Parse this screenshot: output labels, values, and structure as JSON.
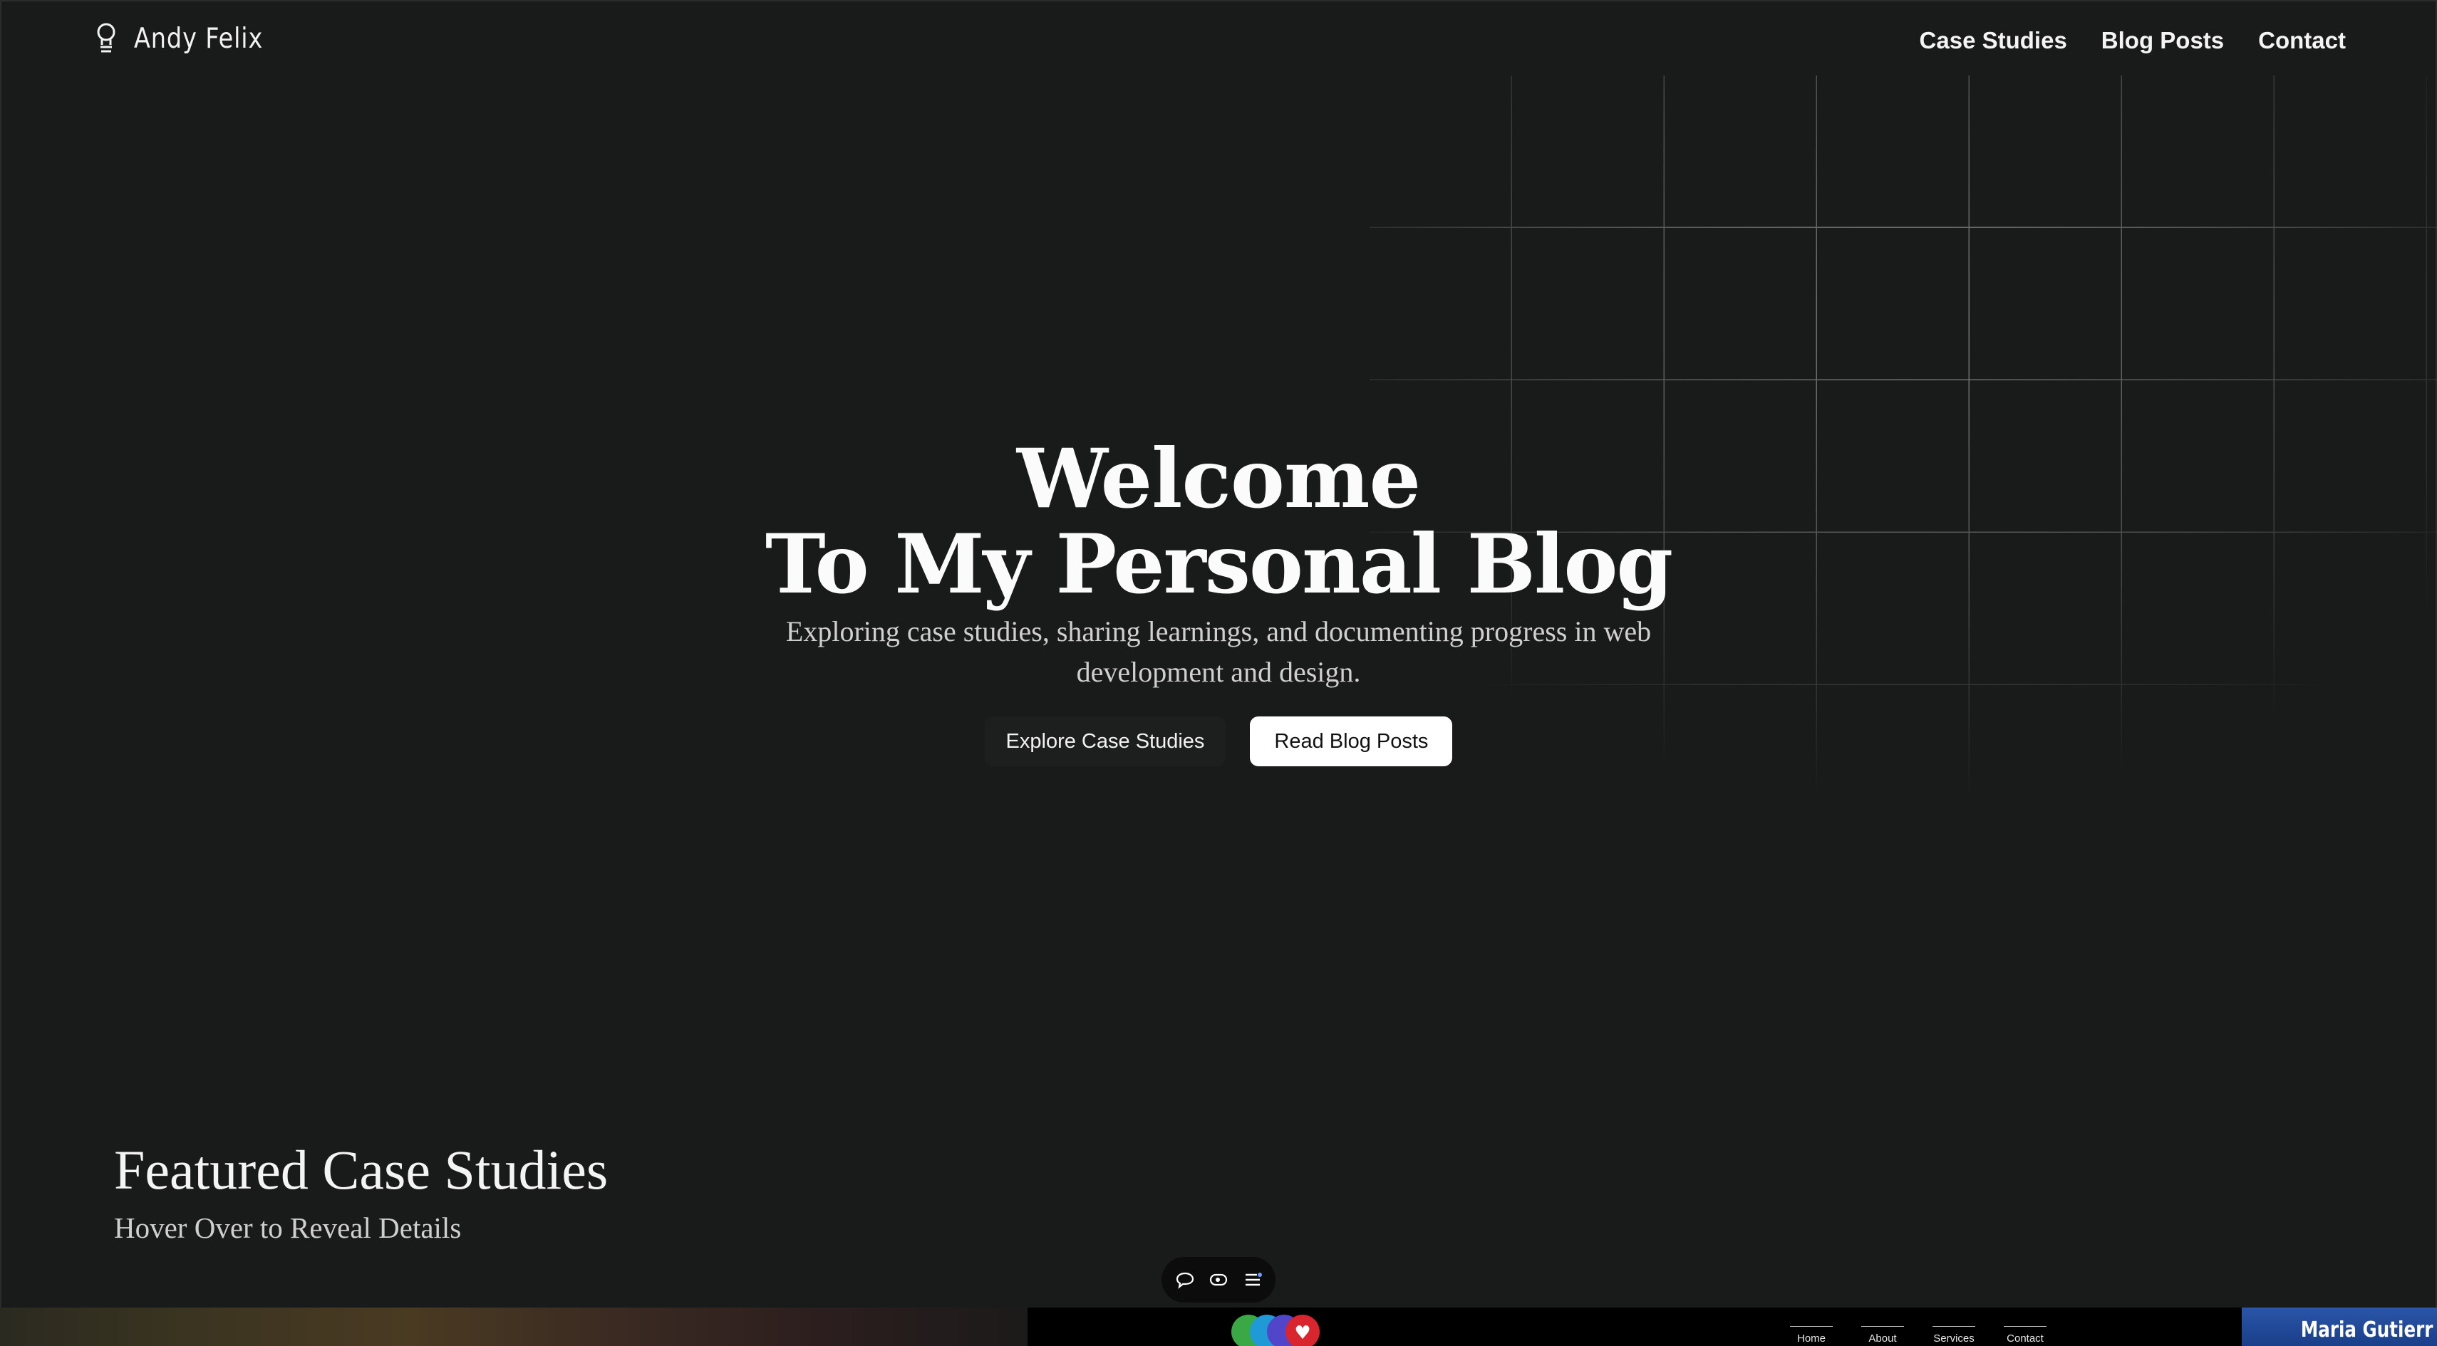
{
  "header": {
    "brand": "Andy Felix",
    "nav": [
      "Case Studies",
      "Blog Posts",
      "Contact"
    ]
  },
  "hero": {
    "title_line1": "Welcome",
    "title_line2": "To My Personal Blog",
    "subtitle": "Exploring case studies, sharing learnings, and documenting progress in web development and design.",
    "cta_primary": "Explore Case Studies",
    "cta_secondary": "Read Blog Posts"
  },
  "featured": {
    "title": "Featured Case Studies",
    "subtitle": "Hover Over to Reveal Details"
  },
  "toolbar": {
    "icons": [
      "chat-icon",
      "eye-icon",
      "menu-icon"
    ]
  },
  "preview_cards": {
    "card2_nav": [
      "Home",
      "About",
      "Services",
      "Contact"
    ],
    "card3_title": "Maria Gutierr"
  },
  "colors": {
    "background": "#191a1a",
    "text": "#ffffff",
    "button_solid": "#ffffff"
  }
}
